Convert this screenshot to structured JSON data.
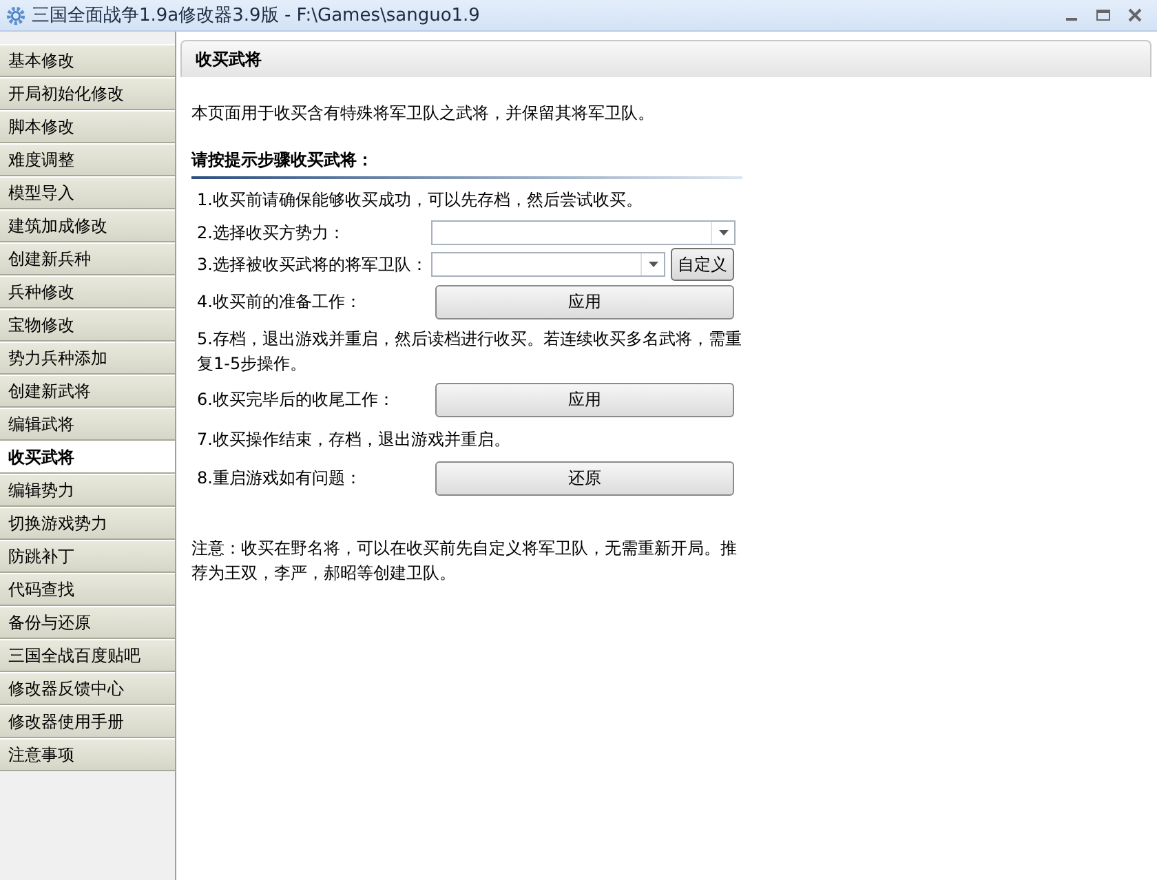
{
  "window": {
    "title": "三国全面战争1.9a修改器3.9版 - F:\\Games\\sanguo1.9"
  },
  "sidebar": {
    "items": [
      {
        "label": "基本修改",
        "selected": false
      },
      {
        "label": "开局初始化修改",
        "selected": false
      },
      {
        "label": "脚本修改",
        "selected": false
      },
      {
        "label": "难度调整",
        "selected": false
      },
      {
        "label": "模型导入",
        "selected": false
      },
      {
        "label": "建筑加成修改",
        "selected": false
      },
      {
        "label": "创建新兵种",
        "selected": false
      },
      {
        "label": "兵种修改",
        "selected": false
      },
      {
        "label": "宝物修改",
        "selected": false
      },
      {
        "label": "势力兵种添加",
        "selected": false
      },
      {
        "label": "创建新武将",
        "selected": false
      },
      {
        "label": "编辑武将",
        "selected": false
      },
      {
        "label": "收买武将",
        "selected": true
      },
      {
        "label": "编辑势力",
        "selected": false
      },
      {
        "label": "切换游戏势力",
        "selected": false
      },
      {
        "label": "防跳补丁",
        "selected": false
      },
      {
        "label": "代码查找",
        "selected": false
      },
      {
        "label": "备份与还原",
        "selected": false
      },
      {
        "label": "三国全战百度贴吧",
        "selected": false
      },
      {
        "label": "修改器反馈中心",
        "selected": false
      },
      {
        "label": "修改器使用手册",
        "selected": false
      },
      {
        "label": "注意事项",
        "selected": false
      }
    ]
  },
  "panel": {
    "title": "收买武将",
    "intro": "本页面用于收买含有特殊将军卫队之武将，并保留其将军卫队。",
    "section_heading": "请按提示步骤收买武将：",
    "steps": [
      {
        "kind": "text",
        "text": "1.收买前请确保能够收买成功，可以先存档，然后尝试收买。"
      },
      {
        "kind": "select",
        "text": "2.选择收买方势力："
      },
      {
        "kind": "select_button",
        "text": "3.选择被收买武将的将军卫队：",
        "button": "自定义"
      },
      {
        "kind": "button",
        "text": "4.收买前的准备工作：",
        "button": "应用"
      },
      {
        "kind": "text",
        "text": "5.存档，退出游戏并重启，然后读档进行收买。若连续收买多名武将，需重复1-5步操作。"
      },
      {
        "kind": "button",
        "text": "6.收买完毕后的收尾工作：",
        "button": "应用"
      },
      {
        "kind": "text",
        "text": "7.收买操作结束，存档，退出游戏并重启。"
      },
      {
        "kind": "button",
        "text": "8.重启游戏如有问题：",
        "button": "还原"
      }
    ],
    "note": "注意：收买在野名将，可以在收买前先自定义将军卫队，无需重新开局。推荐为王双，李严，郝昭等创建卫队。"
  }
}
